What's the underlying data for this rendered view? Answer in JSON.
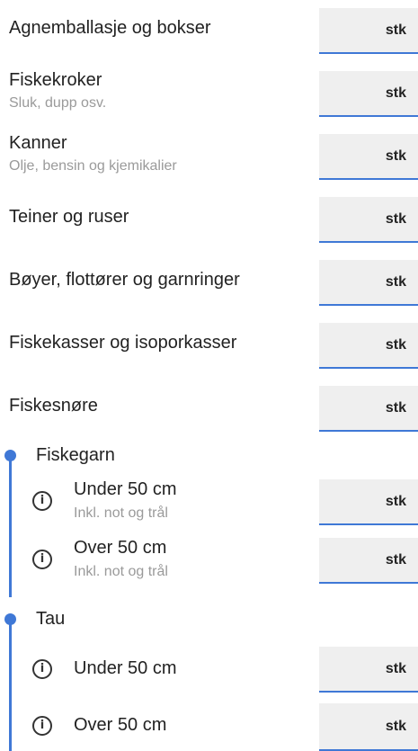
{
  "unit_label": "stk",
  "rows": [
    {
      "label": "Agnemballasje og bokser",
      "sub": ""
    },
    {
      "label": "Fiskekroker",
      "sub": "Sluk, dupp osv."
    },
    {
      "label": "Kanner",
      "sub": "Olje, bensin og kjemikalier"
    },
    {
      "label": "Teiner og ruser",
      "sub": ""
    },
    {
      "label": "Bøyer, flottører og garnringer",
      "sub": ""
    },
    {
      "label": "Fiskekasser og isoporkasser",
      "sub": ""
    },
    {
      "label": "Fiskesnøre",
      "sub": ""
    }
  ],
  "groups": [
    {
      "title": "Fiskegarn",
      "items": [
        {
          "label": "Under 50 cm",
          "sub": "Inkl. not og trål"
        },
        {
          "label": "Over 50 cm",
          "sub": "Inkl. not og trål"
        }
      ]
    },
    {
      "title": "Tau",
      "items": [
        {
          "label": "Under 50 cm",
          "sub": ""
        },
        {
          "label": "Over 50 cm",
          "sub": ""
        }
      ]
    }
  ],
  "icons": {
    "info": "info-icon",
    "info_glyph": "i"
  },
  "colors": {
    "accent": "#3f78d6",
    "field_bg": "#efefef",
    "subtext": "#9a9a9a"
  }
}
